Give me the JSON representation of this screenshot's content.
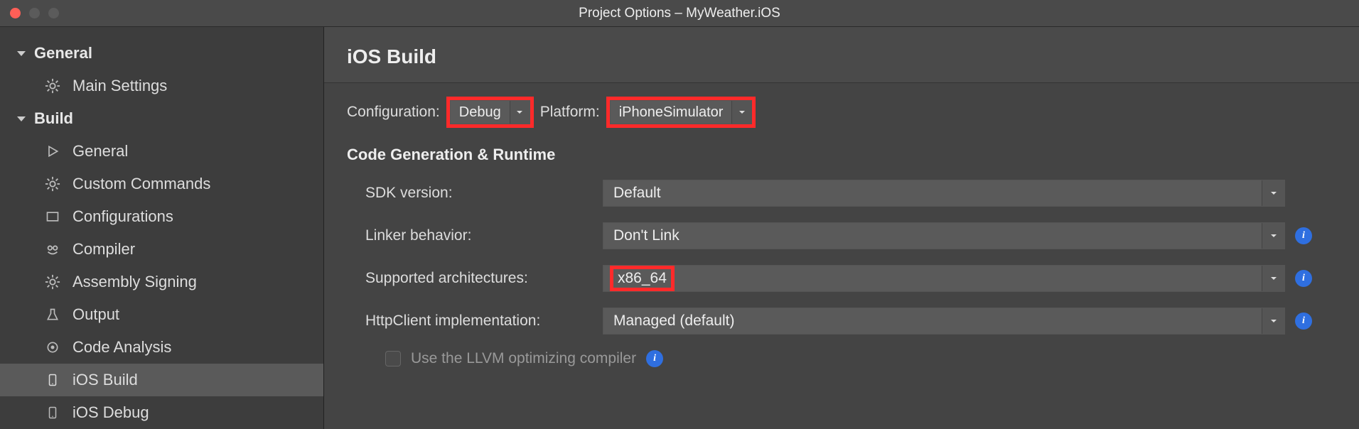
{
  "window": {
    "title": "Project Options – MyWeather.iOS"
  },
  "sidebar": {
    "sections": [
      {
        "label": "General",
        "items": [
          {
            "label": "Main Settings",
            "icon": "gear-icon"
          }
        ]
      },
      {
        "label": "Build",
        "items": [
          {
            "label": "General",
            "icon": "play-icon"
          },
          {
            "label": "Custom Commands",
            "icon": "gear-icon"
          },
          {
            "label": "Configurations",
            "icon": "box-icon"
          },
          {
            "label": "Compiler",
            "icon": "robot-icon"
          },
          {
            "label": "Assembly Signing",
            "icon": "gear-icon"
          },
          {
            "label": "Output",
            "icon": "flask-icon"
          },
          {
            "label": "Code Analysis",
            "icon": "target-icon"
          },
          {
            "label": "iOS Build",
            "icon": "phone-icon",
            "selected": true
          },
          {
            "label": "iOS Debug",
            "icon": "phone-icon"
          }
        ]
      }
    ]
  },
  "page": {
    "title": "iOS Build",
    "config_label": "Configuration:",
    "config_value": "Debug",
    "platform_label": "Platform:",
    "platform_value": "iPhoneSimulator",
    "section_title": "Code Generation & Runtime",
    "rows": {
      "sdk": {
        "label": "SDK version:",
        "value": "Default"
      },
      "linker": {
        "label": "Linker behavior:",
        "value": "Don't Link"
      },
      "arch": {
        "label": "Supported architectures:",
        "value": "x86_64"
      },
      "http": {
        "label": "HttpClient implementation:",
        "value": "Managed (default)"
      }
    },
    "llvm_label": "Use the LLVM optimizing compiler"
  }
}
